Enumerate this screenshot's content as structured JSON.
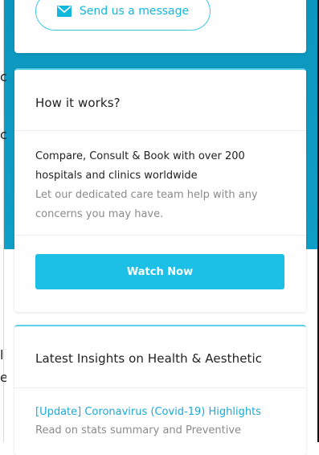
{
  "contact": {
    "send_message_label": "Send us a message",
    "icon": "envelope-icon"
  },
  "how_it_works": {
    "title": "How it works?",
    "line_main": "Compare, Consult & Book with over 200 hospitals and clinics worldwide",
    "line_sub": "Let our dedicated care team help with any concerns you may have.",
    "watch_label": "Watch Now"
  },
  "insights": {
    "title": "Latest Insights on Health & Aesthetic",
    "items": [
      {
        "title": "[Update] Coronavirus (Covid-19) Highlights",
        "summary": "Read on stats summary and Preventive"
      }
    ]
  },
  "colors": {
    "accent": "#1cc0e6",
    "background_teal": "#0f9ec6",
    "text_dark": "#222222",
    "text_muted": "#8a8a8a"
  },
  "left_fragments": [
    "c",
    "c",
    "l",
    "e"
  ]
}
